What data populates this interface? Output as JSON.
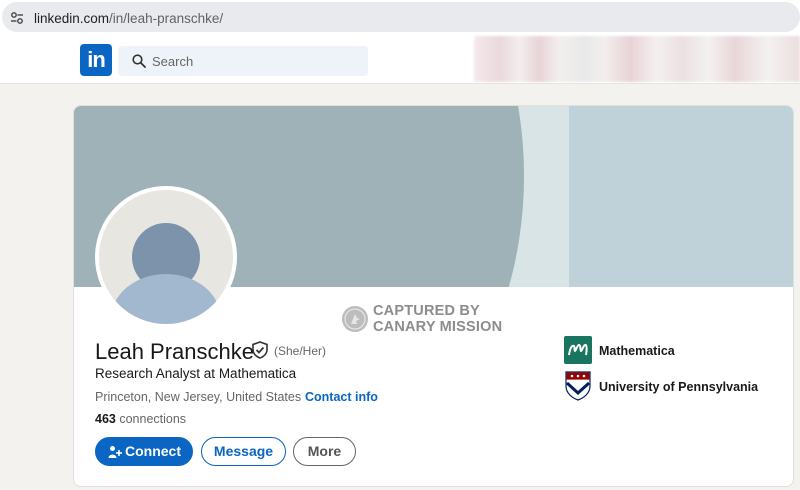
{
  "browser": {
    "url_host": "linkedin.com",
    "url_path": "/in/leah-pranschke/"
  },
  "nav": {
    "logo_text": "in",
    "search_placeholder": "Search"
  },
  "watermark": {
    "line1": "CAPTURED BY",
    "line2": "CANARY MISSION"
  },
  "profile": {
    "name": "Leah Pranschke",
    "pronouns": "(She/Her)",
    "headline": "Research Analyst at Mathematica",
    "location": "Princeton, New Jersey, United States · ",
    "contact_info_label": "Contact info",
    "connections_count": "463",
    "connections_label": " connections"
  },
  "actions": {
    "connect_label": "Connect",
    "message_label": "Message",
    "more_label": "More"
  },
  "experience": {
    "company": "Mathematica",
    "school": "University of Pennsylvania"
  },
  "colors": {
    "linkedin_blue": "#0a66c2",
    "banner": "#9fb2b7",
    "mathematica_green": "#19755f",
    "penn_red": "#990000",
    "penn_blue": "#011f5b"
  }
}
